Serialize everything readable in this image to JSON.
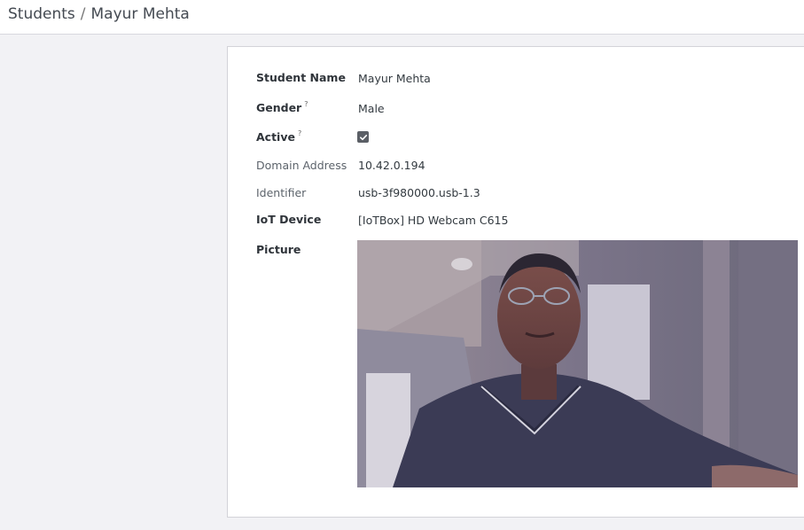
{
  "breadcrumb": {
    "parent": "Students",
    "separator": "/",
    "current": "Mayur Mehta"
  },
  "form": {
    "student_name": {
      "label": "Student Name",
      "value": "Mayur Mehta"
    },
    "gender": {
      "label": "Gender",
      "help": "?",
      "value": "Male"
    },
    "active": {
      "label": "Active",
      "help": "?",
      "checked": true
    },
    "domain_address": {
      "label": "Domain Address",
      "value": "10.42.0.194"
    },
    "identifier": {
      "label": "Identifier",
      "value": "usb-3f980000.usb-1.3"
    },
    "iot_device": {
      "label": "IoT Device",
      "value": "[IoTBox] HD Webcam C615"
    },
    "picture": {
      "label": "Picture"
    }
  },
  "colors": {
    "checkbox_fill": "#5b5f66",
    "sheet_border": "#d3d3d8",
    "background": "#f2f2f5"
  }
}
